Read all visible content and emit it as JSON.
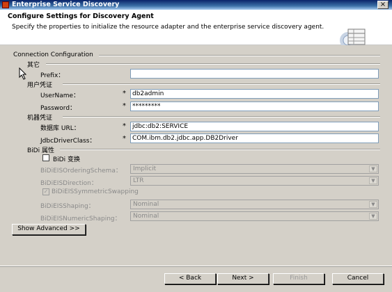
{
  "window": {
    "title": "Enterprise Service Discovery",
    "close_label": "×"
  },
  "banner": {
    "title": "Configure Settings for Discovery Agent",
    "description": "Specify the properties to initialize the resource adapter and the enterprise service discovery agent."
  },
  "connection": {
    "heading": "Connection Configuration",
    "misc": {
      "heading": "其它",
      "prefix_label": "Prefix：",
      "prefix_value": ""
    },
    "user_cred": {
      "heading": "用户凭证",
      "username_label": "UserName：",
      "username_value": "db2admin",
      "password_label": "Password：",
      "password_value": "*********"
    },
    "machine_cred": {
      "heading": "机器凭证",
      "url_label": "数据库 URL：",
      "url_value": "jdbc:db2:SERVICE",
      "driver_label": "JdbcDriverClass：",
      "driver_value": "COM.ibm.db2.jdbc.app.DB2Driver"
    },
    "required_mark": "*",
    "bidi": {
      "heading": "BiDi 属性",
      "transform_label": "BiDi 变换",
      "transform_checked": false,
      "ordering_label": "BiDiEISOrderingSchema：",
      "ordering_value": "Implicit",
      "direction_label": "BiDiEISDirection：",
      "direction_value": "LTR",
      "symmetric_label": "BiDiEISSymmetricSwapping",
      "symmetric_checked": true,
      "shaping_label": "BiDiEISShaping：",
      "shaping_value": "Nominal",
      "numeric_label": "BiDiEISNumericShaping：",
      "numeric_value": "Nominal",
      "dropdown_arrow": "▼"
    },
    "show_advanced_label": "Show Advanced >>"
  },
  "footer": {
    "back_label": "< Back",
    "next_label": "Next >",
    "finish_label": "Finish",
    "cancel_label": "Cancel"
  },
  "colors": {
    "titlebar": "#0a246a",
    "dialog": "#d4d0c8",
    "input_border": "#7f9db9",
    "disabled_text": "#8a8a8a"
  }
}
